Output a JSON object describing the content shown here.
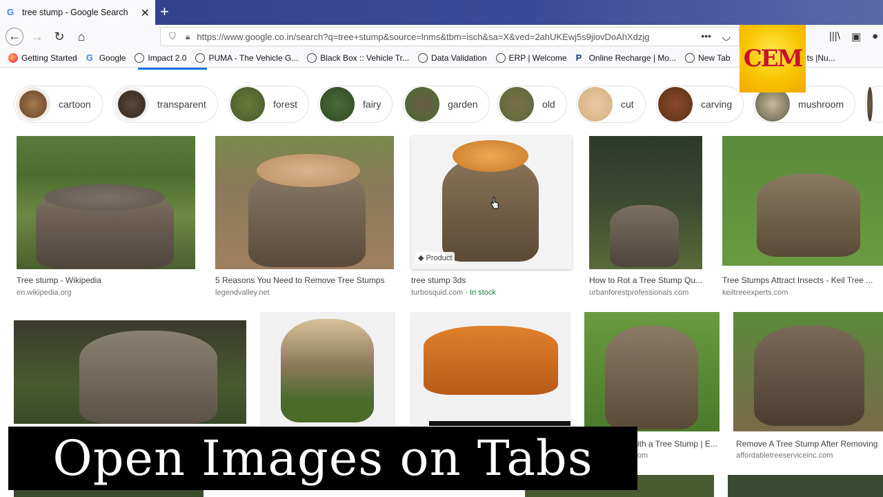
{
  "browser": {
    "tab_title": "tree stump - Google Search",
    "url": "https://www.google.co.in/search?q=tree+stump&source=lnms&tbm=isch&sa=X&ved=2ahUKEwj5s9jiovDoAhXdzjg",
    "bookmarks": [
      {
        "label": "Getting Started",
        "icon": "firefox-icon"
      },
      {
        "label": "Google",
        "icon": "google-icon"
      },
      {
        "label": "Impact 2.0",
        "icon": "globe-icon"
      },
      {
        "label": "PUMA - The Vehicle G...",
        "icon": "globe-icon"
      },
      {
        "label": "Black Box :: Vehicle Tr...",
        "icon": "globe-icon"
      },
      {
        "label": "Data Validation",
        "icon": "globe-icon"
      },
      {
        "label": "ERP | Welcome",
        "icon": "globe-icon"
      },
      {
        "label": "Online Recharge | Mo...",
        "icon": "p-icon"
      },
      {
        "label": "New Tab",
        "icon": "globe-icon"
      },
      {
        "label": "ts |Nu...",
        "icon": "globe-icon"
      }
    ]
  },
  "logo": {
    "text": "CEM"
  },
  "chips": [
    {
      "label": "cartoon"
    },
    {
      "label": "transparent"
    },
    {
      "label": "forest"
    },
    {
      "label": "fairy"
    },
    {
      "label": "garden"
    },
    {
      "label": "old"
    },
    {
      "label": "cut"
    },
    {
      "label": "carving"
    },
    {
      "label": "mushroom"
    }
  ],
  "results_row1": [
    {
      "title": "Tree stump - Wikipedia",
      "source": "en.wikipedia.org"
    },
    {
      "title": "5 Reasons You Need to Remove Tree Stumps",
      "source": "legendvalley.net"
    },
    {
      "title": "tree stump 3ds",
      "source": "turbosquid.com",
      "stock": "· In stock",
      "badge": "Product"
    },
    {
      "title": "How to Rot a Tree Stump Qu...",
      "source": "urbanforestprofessionals.com"
    },
    {
      "title": "Tree Stumps Attract Insects - Keil Tree ...",
      "source": "keiltreeexperts.com"
    }
  ],
  "results_row2": [
    {
      "title": "ith a Tree Stump | E...",
      "source": "om"
    },
    {
      "title": "Remove A Tree Stump After Removing",
      "source": "affordabletreeserviceinc.com"
    }
  ],
  "caption": {
    "text": "Open Images on Tabs"
  }
}
